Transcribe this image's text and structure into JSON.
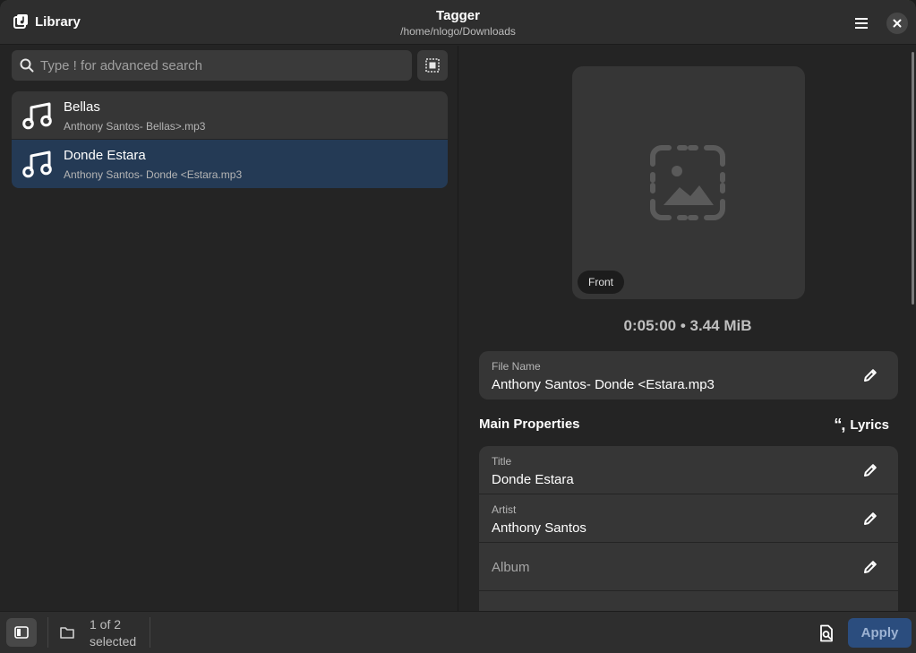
{
  "header": {
    "library_label": "Library",
    "app_title": "Tagger",
    "path": "/home/nlogo/Downloads"
  },
  "search": {
    "placeholder": "Type ! for advanced search"
  },
  "files": [
    {
      "name": "Bellas",
      "filename": "Anthony Santos- Bellas>.mp3",
      "selected": false
    },
    {
      "name": "Donde Estara",
      "filename": "Anthony Santos- Donde <Estara.mp3",
      "selected": true
    }
  ],
  "details": {
    "art_badge": "Front",
    "duration_size": "0:05:00 • 3.44 MiB",
    "file_name_label": "File Name",
    "file_name_value": "Anthony Santos- Donde <Estara.mp3",
    "section_title": "Main Properties",
    "lyrics_label": "Lyrics",
    "lyrics_quote": "“,",
    "properties": [
      {
        "label": "Title",
        "value": "Donde Estara"
      },
      {
        "label": "Artist",
        "value": "Anthony Santos"
      },
      {
        "label": "",
        "value": "",
        "placeholder": "Album"
      }
    ]
  },
  "bottom": {
    "selection_line1": "1 of 2",
    "selection_line2": "selected",
    "apply_label": "Apply"
  },
  "colors": {
    "accent_selected_row": "#243a55",
    "apply_button": "#2b4d7e",
    "card_bg": "#363636",
    "window_bg": "#242424"
  },
  "icons": {
    "library": "library-icon",
    "menu": "hamburger-menu-icon",
    "close": "close-icon",
    "search": "search-icon",
    "select_mode": "selection-mode-icon",
    "file": "music-note-icon",
    "art_placeholder": "image-missing-icon",
    "edit": "pencil-icon",
    "sidebar": "sidebar-toggle-icon",
    "folder": "folder-icon",
    "doc": "document-search-icon"
  }
}
